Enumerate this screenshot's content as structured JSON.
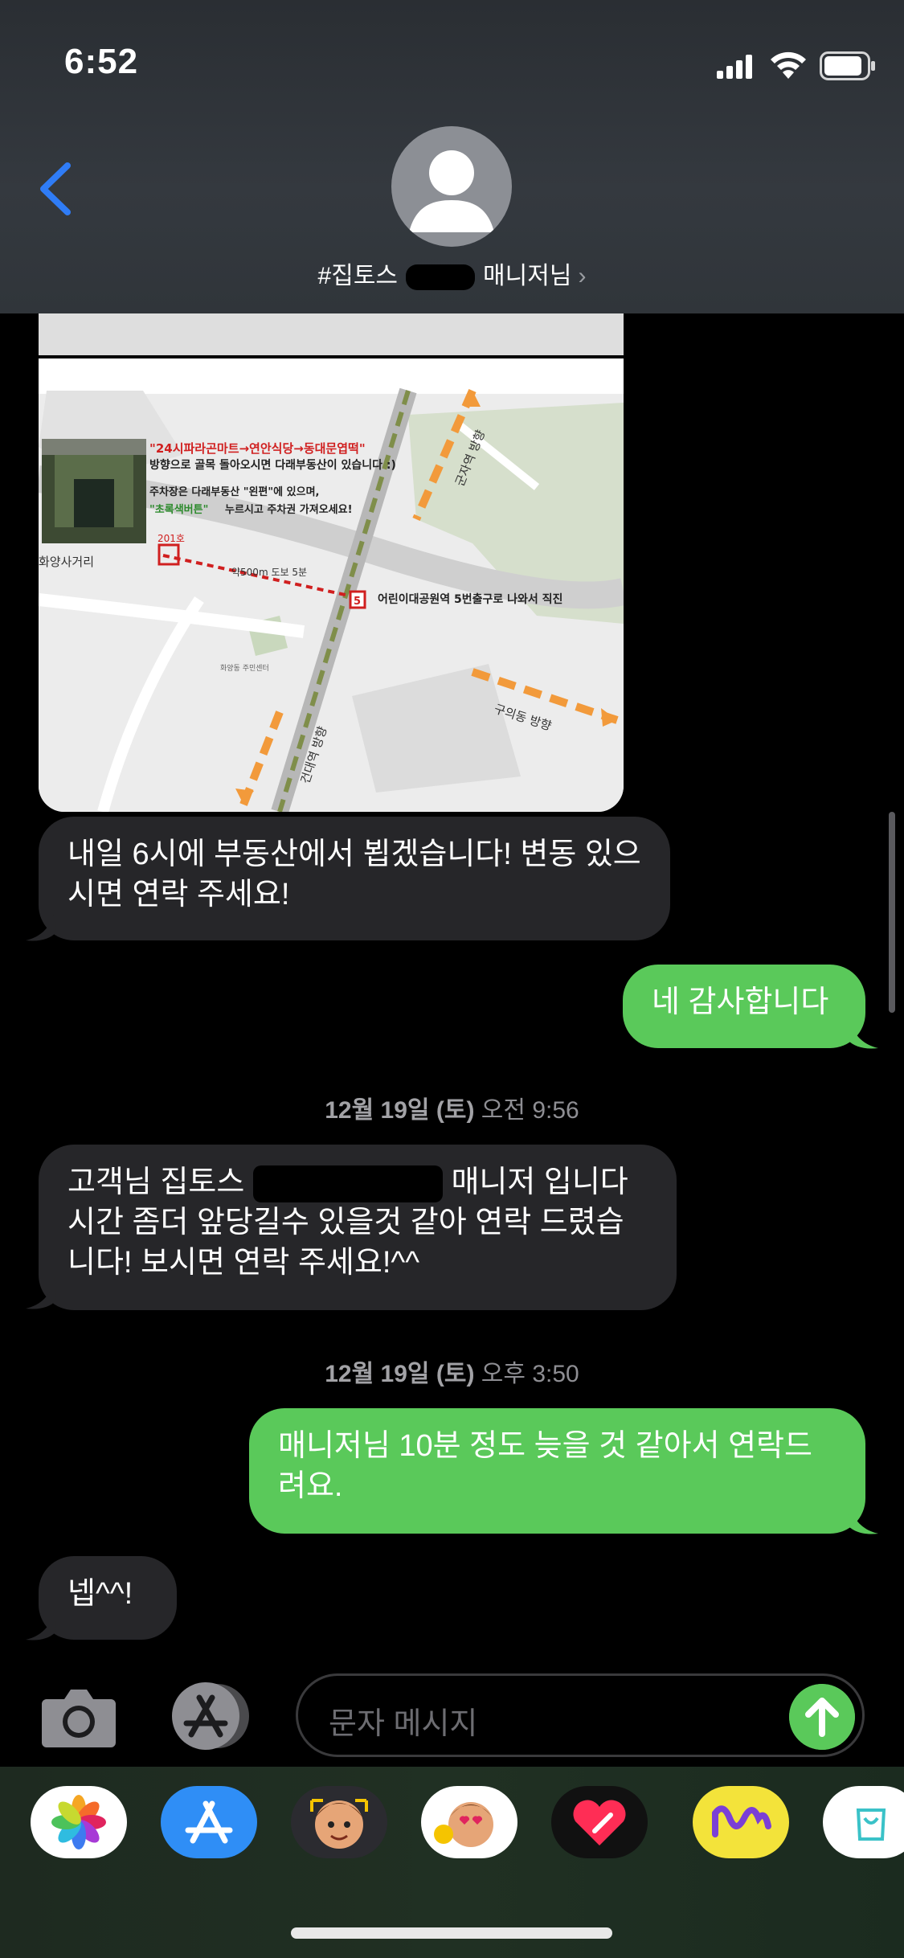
{
  "status_bar": {
    "time": "6:52"
  },
  "header": {
    "contact_prefix": "#집토스",
    "contact_suffix": "매니저님"
  },
  "map": {
    "route_line1": "\"24시파라곤마트→연안식당→동대문엽떡\"",
    "route_line2": "방향으로 골목 돌아오시면 다래부동산이 있습니다 :)",
    "parking_line1": "주차장은 다래부동산 \"왼편\"에 있으며,",
    "parking_line2_a": "\"초록색버튼\"",
    "parking_line2_b": "누르시고 주차권 가져오세요!",
    "unit": "201호",
    "intersection": "화양사거리",
    "walk": "약500m 도보 5분",
    "exit_marker": "5",
    "exit_label": "어린이대공원역 5번출구로 나와서 직진",
    "dir_gunja": "군자역 방향",
    "dir_guui": "구의동 방향",
    "dir_kondae": "건대역 방향",
    "center": "화양동 주민센터"
  },
  "messages": [
    {
      "dir": "in",
      "text": "내일 6시에 부동산에서 뵙겠습니다! 변동 있으시면 연락 주세요!"
    },
    {
      "dir": "out",
      "text": "네 감사합니다"
    },
    {
      "dir": "stamp",
      "day": "12월 19일 (토)",
      "time": "오전 9:56"
    },
    {
      "dir": "in",
      "text_a": "고객님 집토스",
      "text_b": "매니저 입니다 시간 좀더 앞당길수 있을것 같아 연락 드렸습니다! 보시면 연락 주세요!^^"
    },
    {
      "dir": "stamp",
      "day": "12월 19일 (토)",
      "time": "오후 3:50"
    },
    {
      "dir": "out",
      "text": "매니저님 10분 정도 늦을 것 같아서 연락드려요."
    },
    {
      "dir": "in",
      "text": "넵^^!"
    }
  ],
  "composer": {
    "placeholder": "문자 메시지"
  },
  "app_drawer": [
    "photos-app",
    "app-store-app",
    "memoji-app",
    "memoji-stickers-app",
    "digital-touch-app",
    "music-app",
    "store-app"
  ],
  "colors": {
    "sent_bubble": "#5ac95a",
    "received_bubble": "#262629",
    "accent_blue": "#2f7cf6"
  }
}
